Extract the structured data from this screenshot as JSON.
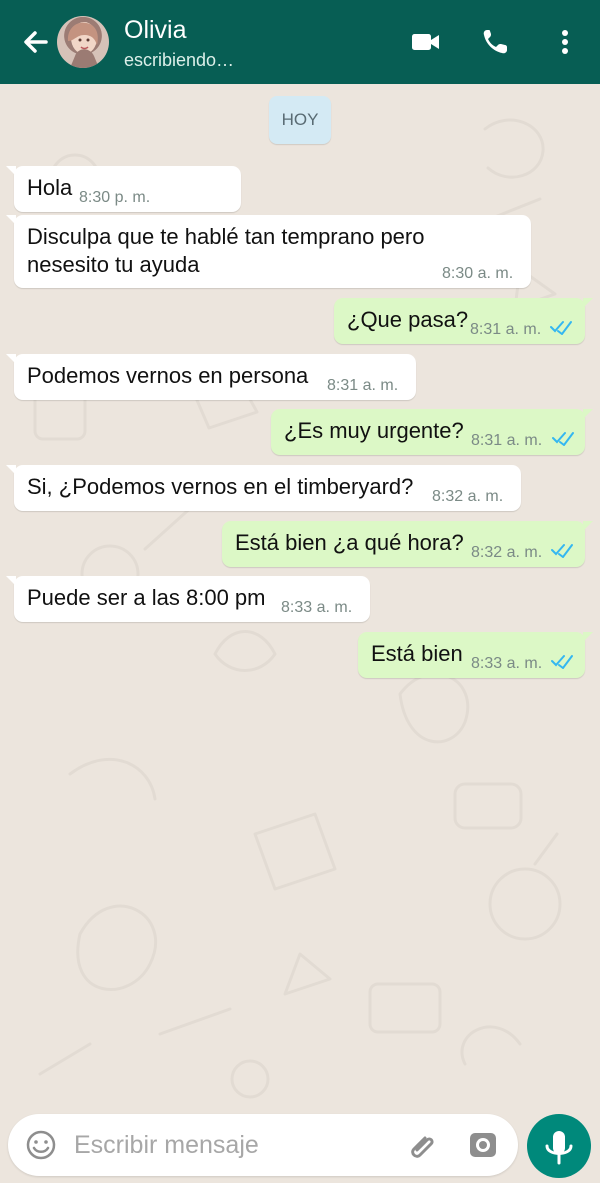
{
  "header": {
    "contact_name": "Olivia",
    "status": "escribiendo…",
    "icons": [
      "back-arrow-icon",
      "video-call-icon",
      "phone-icon",
      "more-options-icon"
    ]
  },
  "chat": {
    "day_label": "HOY",
    "messages": [
      {
        "type": "incoming",
        "text": "Hola",
        "time": "8:30 p. m."
      },
      {
        "type": "incoming",
        "text": "Disculpa que te hablé tan temprano pero\nnesesito tu ayuda",
        "time": "8:30 a. m."
      },
      {
        "type": "outgoing",
        "text": "¿Que pasa?",
        "time": "8:31 a. m.",
        "read": true
      },
      {
        "type": "incoming",
        "text": "Podemos vernos en persona",
        "time": "8:31 a. m."
      },
      {
        "type": "outgoing",
        "text": "¿Es muy urgente?",
        "time": "8:31 a. m.",
        "read": true
      },
      {
        "type": "incoming",
        "text": "Si, ¿Podemos vernos en el timberyard?",
        "time": "8:32 a. m."
      },
      {
        "type": "outgoing",
        "text": "Está bien ¿a qué hora?",
        "time": "8:32 a. m.",
        "read": true
      },
      {
        "type": "incoming",
        "text": "Puede ser a las 8:00 pm",
        "time": "8:33 a. m."
      },
      {
        "type": "outgoing",
        "text": "Está bien",
        "time": "8:33 a. m.",
        "read": true
      }
    ]
  },
  "composer": {
    "placeholder": "Escribir mensaje",
    "icons": [
      "emoji-icon",
      "attach-icon",
      "camera-icon",
      "microphone-icon"
    ]
  },
  "colors": {
    "header": "#075e54",
    "background": "#ece5dd",
    "incoming": "#ffffff",
    "outgoing": "#dcf8c6",
    "read_ticks": "#34b7f1",
    "mic_button": "#00897b"
  }
}
